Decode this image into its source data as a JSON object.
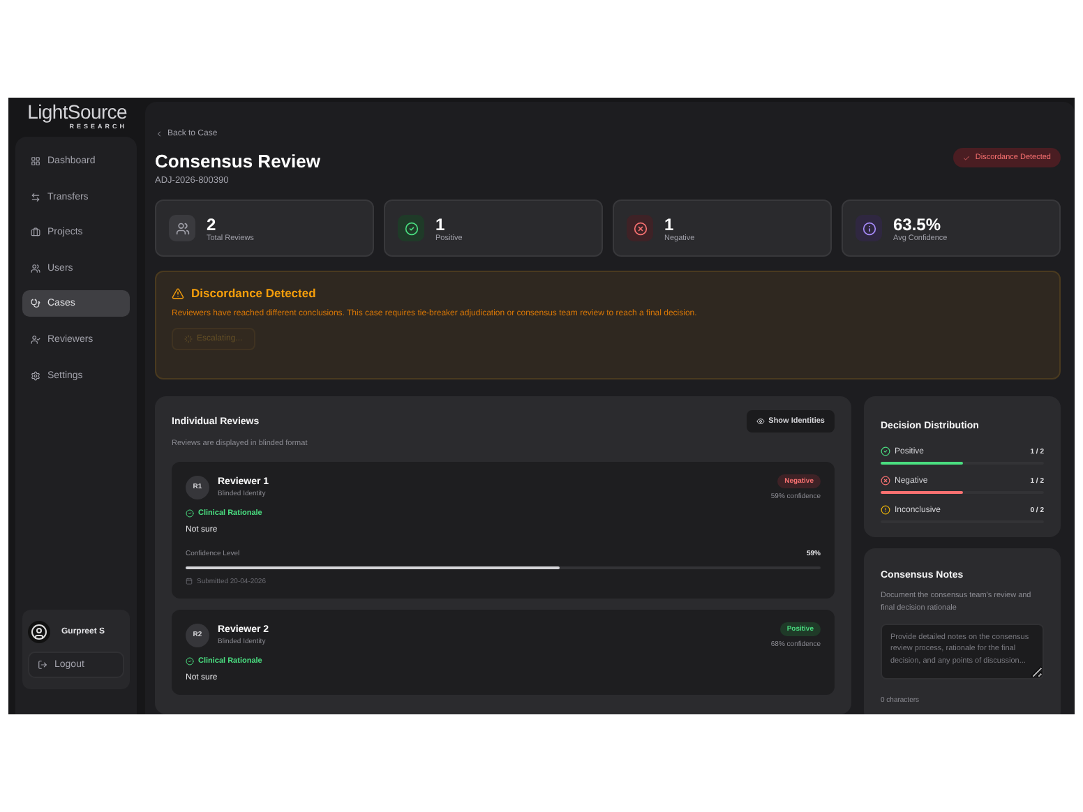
{
  "brand": {
    "name": "LightSource",
    "tagline": "RESEARCH"
  },
  "nav": [
    {
      "label": "Dashboard",
      "selected": false
    },
    {
      "label": "Transfers",
      "selected": false
    },
    {
      "label": "Projects",
      "selected": false
    },
    {
      "label": "Users",
      "selected": false
    },
    {
      "label": "Cases",
      "selected": true
    },
    {
      "label": "Reviewers",
      "selected": false
    },
    {
      "label": "Settings",
      "selected": false
    }
  ],
  "user": {
    "name": "Gurpreet S",
    "logout": "Logout"
  },
  "header": {
    "back": "Back to Case",
    "title": "Consensus Review",
    "case_id": "ADJ-2026-800390",
    "status_badge": "Discordance Detected"
  },
  "stats": [
    {
      "value": "2",
      "label": "Total Reviews",
      "kind": "total"
    },
    {
      "value": "1",
      "label": "Positive",
      "kind": "positive"
    },
    {
      "value": "1",
      "label": "Negative",
      "kind": "negative"
    },
    {
      "value": "63.5%",
      "label": "Avg Confidence",
      "kind": "info"
    }
  ],
  "alert": {
    "title": "Discordance Detected",
    "message": "Reviewers have reached different conclusions. This case requires tie-breaker adjudication or consensus team review to reach a final decision.",
    "button": "Escalating...",
    "disabled": true
  },
  "reviews": {
    "title": "Individual Reviews",
    "subtitle": "Reviews are displayed in blinded format",
    "toggle": "Show Identities",
    "items": [
      {
        "avatar": "R1",
        "name": "Reviewer 1",
        "identity": "Blinded Identity",
        "decision": "Negative",
        "kind": "negative",
        "confidence": "59% confidence",
        "rationale_label": "Clinical Rationale",
        "rationale": "Not sure",
        "confidence_label": "Confidence Level",
        "confidence_value": "59%",
        "level": 0.59,
        "submitted": "Submitted 20-04-2026"
      },
      {
        "avatar": "R2",
        "name": "Reviewer 2",
        "identity": "Blinded Identity",
        "decision": "Positive",
        "kind": "positive",
        "confidence": "68% confidence",
        "rationale_label": "Clinical Rationale",
        "rationale": "Not sure"
      }
    ]
  },
  "distribution": {
    "title": "Decision Distribution",
    "items": [
      {
        "label": "Positive",
        "kind": "positive",
        "count": "1 / 2",
        "level": 0.5
      },
      {
        "label": "Negative",
        "kind": "negative",
        "count": "1 / 2",
        "level": 0.5
      },
      {
        "label": "Inconclusive",
        "kind": "inconclusive",
        "count": "0 / 2",
        "level": 0
      }
    ]
  },
  "notes": {
    "title": "Consensus Notes",
    "description": "Document the consensus team's review and final decision rationale",
    "placeholder": "Provide detailed notes on the consensus review process, rationale for the final decision, and any points of discussion...",
    "count": "0 characters"
  }
}
